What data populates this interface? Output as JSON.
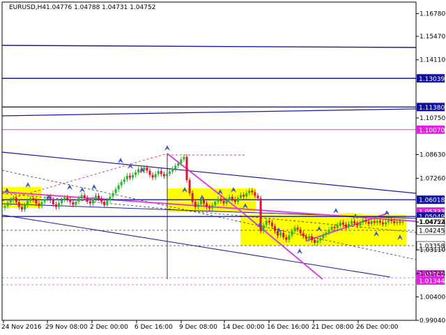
{
  "header": {
    "symbol": "EURUSD,H4",
    "ohlc": "1.04776 1.04788 1.04731 1.04752"
  },
  "colors": {
    "axis": "#000000",
    "candle_up": "#2ab52a",
    "candle_down": "#e0142c",
    "highlight": "#ffff00",
    "trend_blue": "#1a1aa0",
    "magenta": "#e040e0",
    "price_label_bg": "#1010a0",
    "magenta_label_bg": "#e020e0",
    "marker": "#3a5acc"
  },
  "chart_data": {
    "type": "candlestick",
    "title": "EURUSD,H4",
    "subtitle": "1.04776 1.04788 1.04731 1.04752",
    "x_tick_labels": [
      "24 Nov 2016",
      "29 Nov 08:00",
      "2 Dec 00:00",
      "6 Dec 16:00",
      "9 Dec 08:00",
      "14 Dec 00:00",
      "16 Dec 16:00",
      "21 Dec 08:00",
      "26 Dec 00:00"
    ],
    "y_tick_labels": [
      "1.16780",
      "1.15470",
      "1.14110",
      "1.10750",
      "1.08630",
      "1.07260",
      "1.04724",
      "1.03110",
      "1.01744",
      "1.00400",
      "0.99040"
    ],
    "ylim": [
      0.9904,
      1.1745
    ],
    "grid": false,
    "price_levels": [
      {
        "label": "1.13039",
        "value": 1.13039,
        "style": "blue"
      },
      {
        "label": "1.11380",
        "value": 1.1138,
        "style": "blue"
      },
      {
        "label": "1.10070",
        "value": 1.1007,
        "style": "magenta"
      },
      {
        "label": "1.06018",
        "value": 1.06018,
        "style": "blue"
      },
      {
        "label": "1.05333",
        "value": 1.05333,
        "style": "magenta"
      },
      {
        "label": "1.05049",
        "value": 1.05049,
        "style": "blue"
      },
      {
        "label": "1.04752",
        "value": 1.04752,
        "style": "black"
      },
      {
        "label": "1.04245",
        "value": 1.04245,
        "style": "black"
      },
      {
        "label": "1.03358",
        "value": 1.03358,
        "style": "black"
      },
      {
        "label": "1.01702",
        "value": 1.01702,
        "style": "magenta"
      },
      {
        "label": "1.01344",
        "value": 1.01344,
        "style": "magenta"
      }
    ],
    "series": [
      {
        "x": [
          0,
          1,
          2,
          3,
          4,
          5,
          6,
          7,
          8,
          9,
          10,
          11,
          12,
          13,
          14,
          15,
          16,
          17,
          18,
          19,
          20,
          21,
          22,
          23,
          24,
          25,
          26,
          27,
          28,
          29,
          30,
          31,
          32,
          33,
          34,
          35,
          36,
          37,
          38,
          39,
          40,
          41,
          42,
          43,
          44,
          45,
          46,
          47,
          48,
          49,
          50,
          51,
          52,
          53,
          54,
          55,
          56,
          57,
          58,
          59,
          60,
          61,
          62,
          63,
          64,
          65,
          66,
          67,
          68,
          69,
          70,
          71,
          72,
          73,
          74,
          75,
          76,
          77,
          78,
          79,
          80,
          81,
          82,
          83,
          84,
          85,
          86,
          87,
          88,
          89,
          90,
          91,
          92,
          93,
          94,
          95,
          96,
          97,
          98,
          99,
          100,
          101,
          102,
          103,
          104,
          105,
          106,
          107,
          108,
          109,
          110,
          111,
          112,
          113,
          114,
          115,
          116,
          117,
          118,
          119,
          120,
          121,
          122,
          123,
          124,
          125,
          126,
          127,
          128,
          129,
          130,
          131,
          132,
          133,
          134,
          135,
          136,
          137,
          138,
          139,
          140
        ],
        "close": [
          1.0565,
          1.0585,
          1.0598,
          1.0612,
          1.0588,
          1.056,
          1.0545,
          1.057,
          1.0595,
          1.061,
          1.06,
          1.058,
          1.0565,
          1.0588,
          1.0605,
          1.062,
          1.0598,
          1.0575,
          1.056,
          1.0582,
          1.06,
          1.0615,
          1.0603,
          1.0588,
          1.0572,
          1.059,
          1.061,
          1.0628,
          1.0612,
          1.0592,
          1.058,
          1.0605,
          1.0625,
          1.061,
          1.059,
          1.057,
          1.0598,
          1.062,
          1.064,
          1.0662,
          1.0685,
          1.0705,
          1.072,
          1.074,
          1.073,
          1.0745,
          1.076,
          1.0778,
          1.077,
          1.0788,
          1.077,
          1.0745,
          1.073,
          1.075,
          1.0768,
          1.075,
          1.0738,
          1.0752,
          1.0765,
          1.078,
          1.0798,
          1.0812,
          1.0835,
          1.085,
          1.0715,
          1.064,
          1.059,
          1.056,
          1.0575,
          1.0598,
          1.058,
          1.056,
          1.0552,
          1.057,
          1.059,
          1.0608,
          1.0595,
          1.058,
          1.06,
          1.0618,
          1.0605,
          1.059,
          1.0612,
          1.063,
          1.062,
          1.064,
          1.0655,
          1.0645,
          1.0625,
          1.061,
          1.042,
          1.0455,
          1.048,
          1.047,
          1.0448,
          1.042,
          1.0395,
          1.041,
          1.0385,
          1.037,
          1.0395,
          1.042,
          1.044,
          1.043,
          1.0408,
          1.039,
          1.0375,
          1.039,
          1.0368,
          1.0352,
          1.0365,
          1.038,
          1.0398,
          1.0412,
          1.0428,
          1.0445,
          1.0438,
          1.0455,
          1.047,
          1.0458,
          1.0445,
          1.0462,
          1.0478,
          1.0465,
          1.0452,
          1.047,
          1.0485,
          1.0475,
          1.0462,
          1.0478,
          1.0468,
          1.048,
          1.047,
          1.046,
          1.0472,
          1.0485,
          1.0478,
          1.0466,
          1.0475,
          1.047,
          1.0475
        ]
      }
    ]
  }
}
